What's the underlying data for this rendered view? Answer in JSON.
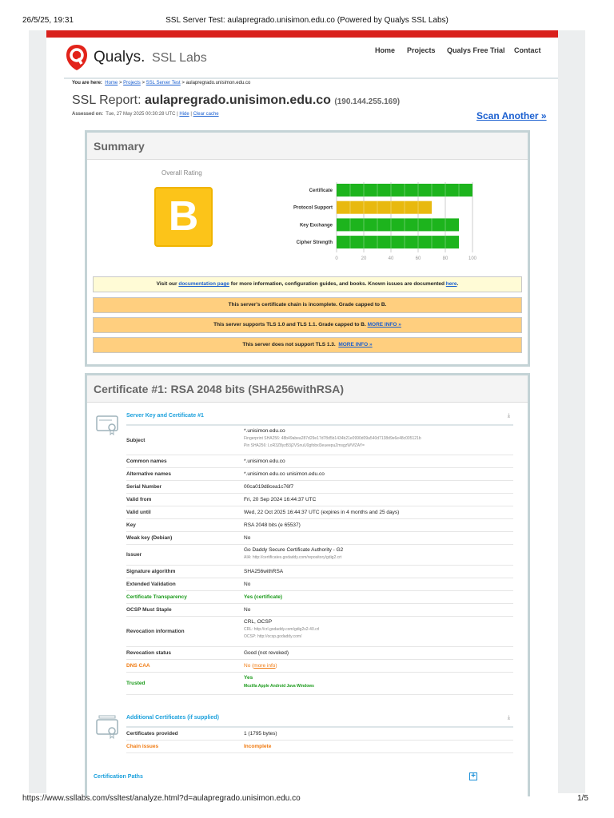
{
  "print_header": {
    "datetime": "26/5/25, 19:31",
    "title": "SSL Server Test: aulapregrado.unisimon.edu.co (Powered by Qualys SSL Labs)"
  },
  "print_footer": {
    "url": "https://www.ssllabs.com/ssltest/analyze.html?d=aulapregrado.unisimon.edu.co",
    "page": "1/5"
  },
  "logo": {
    "brand": "Qualys.",
    "product": "SSL Labs"
  },
  "nav": [
    "Home",
    "Projects",
    "Qualys Free Trial",
    "Contact"
  ],
  "breadcrumb": {
    "prefix": "You are here:",
    "items": [
      "Home",
      "Projects",
      "SSL Server Test"
    ],
    "current": "aulapregrado.unisimon.edu.co",
    "sep": ">"
  },
  "report": {
    "title_prefix": "SSL Report:",
    "host": "aulapregrado.unisimon.edu.co",
    "ip": "(190.144.255.169)",
    "assessed_label": "Assessed on:",
    "assessed": "Tue, 27 May 2025 00:30:28 UTC |",
    "hide": "Hide",
    "clear": "Clear cache",
    "scan_another": "Scan Another »"
  },
  "summary": {
    "title": "Summary",
    "overall_label": "Overall Rating",
    "grade": "B",
    "messages": [
      {
        "pre": "Visit our ",
        "link": "documentation page",
        "post": " for more information, configuration guides, and books. Known issues are documented ",
        "link2": "here",
        "end": "."
      },
      {
        "text": "This server's certificate chain is incomplete. Grade capped to B."
      },
      {
        "text": "This server supports TLS 1.0 and TLS 1.1. Grade capped to B.",
        "link": "MORE INFO »"
      },
      {
        "text": "This server does not support TLS 1.3.",
        "link": "MORE INFO »"
      }
    ]
  },
  "chart_data": {
    "type": "bar",
    "orientation": "horizontal",
    "categories": [
      "Certificate",
      "Protocol Support",
      "Key Exchange",
      "Cipher Strength"
    ],
    "values": [
      100,
      70,
      90,
      90
    ],
    "colors": [
      "#1db41d",
      "#e8b90f",
      "#1db41d",
      "#1db41d"
    ],
    "xlim": [
      0,
      100
    ],
    "xticks": [
      "0",
      "20",
      "40",
      "60",
      "80",
      "100"
    ],
    "grid": true
  },
  "cert": {
    "title": "Certificate #1: RSA 2048 bits (SHA256withRSA)",
    "section1": "Server Key and Certificate #1",
    "rows": [
      {
        "label": "Subject",
        "value": "*.unisimon.edu.co",
        "sub": [
          "Fingerprint SHA256: 48b49abea287d29e17d78d5b1434b21e0990d09a540d7138d9e6e48c005121b",
          "Pin SHA256: LoR3Z8yzB3j2VSnuU0gfobxl3eueepuZmsgzWVfZAY="
        ]
      },
      {
        "label": "Common names",
        "value": "*.unisimon.edu.co"
      },
      {
        "label": "Alternative names",
        "value": "*.unisimon.edu.co unisimon.edu.co"
      },
      {
        "label": "Serial Number",
        "value": "00ca019d8cea1c76f7"
      },
      {
        "label": "Valid from",
        "value": "Fri, 20 Sep 2024 16:44:37 UTC"
      },
      {
        "label": "Valid until",
        "value": "Wed, 22 Oct 2025 16:44:37 UTC (expires in 4 months and 25 days)"
      },
      {
        "label": "Key",
        "value": "RSA 2048 bits (e 65537)"
      },
      {
        "label": "Weak key (Debian)",
        "value": "No"
      },
      {
        "label": "Issuer",
        "value": "Go Daddy Secure Certificate Authority - G2",
        "sub": [
          "AIA: http://certificates.godaddy.com/repository/gdig2.crt"
        ]
      },
      {
        "label": "Signature algorithm",
        "value": "SHA256withRSA"
      },
      {
        "label": "Extended Validation",
        "value": "No"
      },
      {
        "label": "Certificate Transparency",
        "value": "Yes (certificate)"
      },
      {
        "label": "OCSP Must Staple",
        "value": "No"
      },
      {
        "label": "Revocation information",
        "value": "CRL, OCSP",
        "sub": [
          "CRL: http://crl.godaddy.com/gdig2s2-40.crl",
          "OCSP: http://ocsp.godaddy.com/"
        ]
      },
      {
        "label": "Revocation status",
        "value": "Good (not revoked)"
      },
      {
        "label": "DNS CAA",
        "value": "No (",
        "link": "more info",
        "end": ")"
      },
      {
        "label": "Trusted",
        "value": "Yes",
        "stores": "Mozilla  Apple  Android  Java  Windows"
      }
    ],
    "section2": "Additional Certificates (if supplied)",
    "rows2": [
      {
        "label": "Certificates provided",
        "value": "1 (1795 bytes)"
      },
      {
        "label": "Chain issues",
        "value": "Incomplete"
      }
    ],
    "paths": "Certification Paths"
  }
}
